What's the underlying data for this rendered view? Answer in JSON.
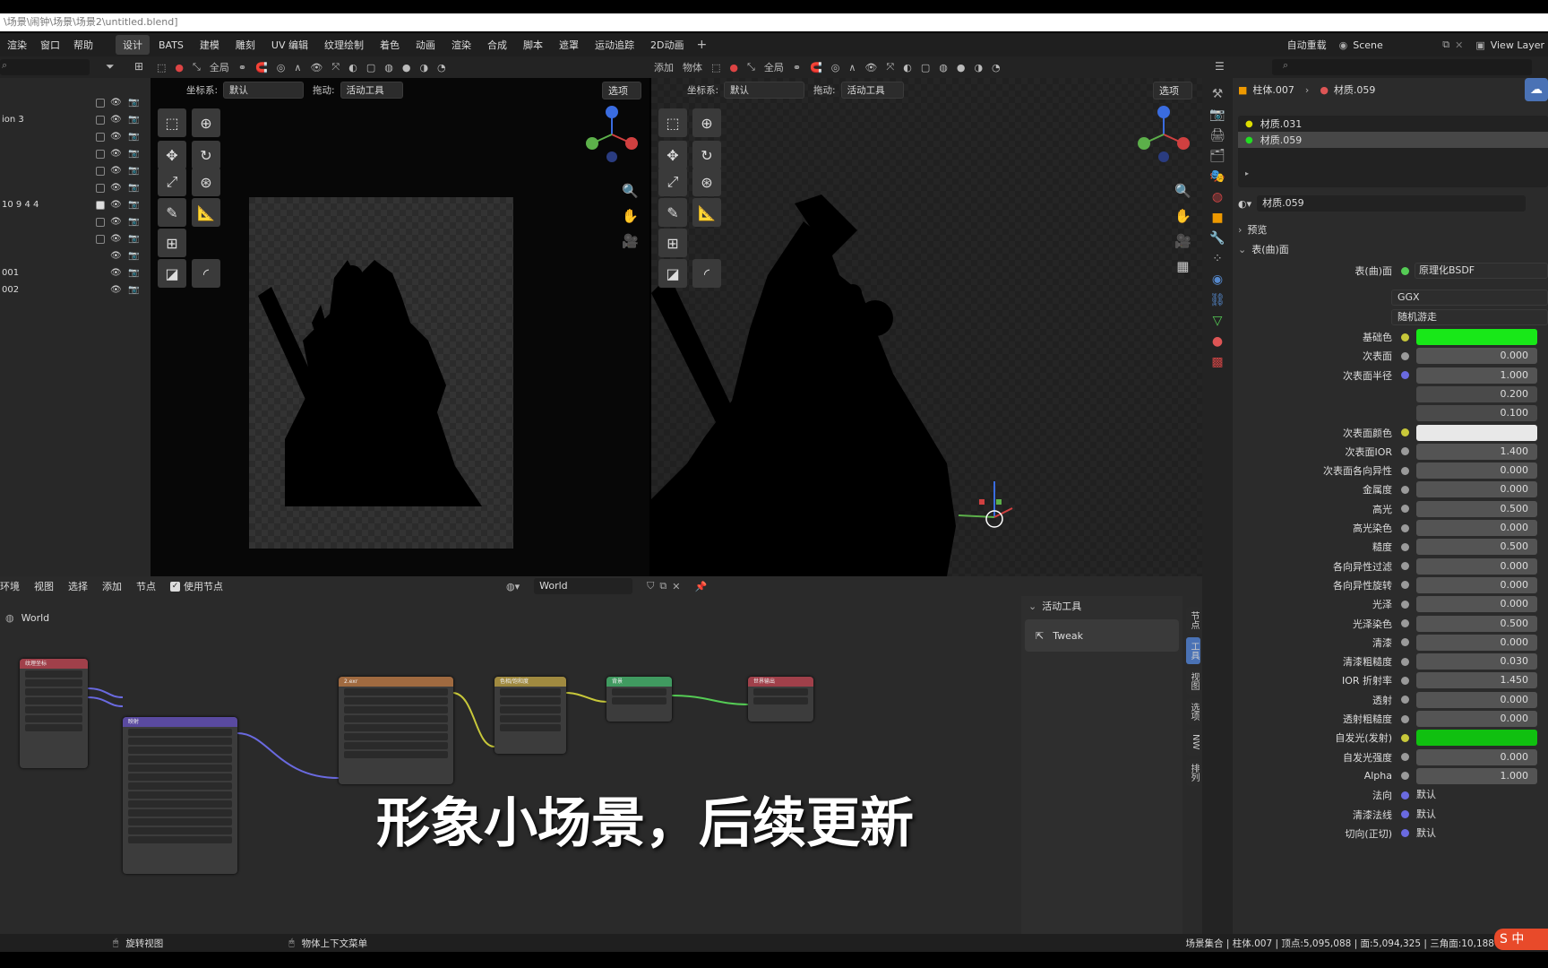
{
  "titlebar": {
    "path": "\\场景\\闹钟\\场景\\场景2\\untitled.blend]"
  },
  "menu": [
    "渲染",
    "窗口",
    "帮助"
  ],
  "workspaces": [
    "设计",
    "BATS",
    "建模",
    "雕刻",
    "UV 编辑",
    "纹理绘制",
    "着色",
    "动画",
    "渲染",
    "合成",
    "脚本",
    "遮罩",
    "运动追踪",
    "2D动画"
  ],
  "active_workspace": "设计",
  "auto_keying": "自动重载",
  "scene": "Scene",
  "view_layer": "View Layer",
  "viewport_left": {
    "coord_label": "坐标系:",
    "coord_value": "默认",
    "drag_label": "拖动:",
    "drag_value": "活动工具",
    "options": "选项",
    "global": "全局"
  },
  "viewport_right": {
    "coord_label": "坐标系:",
    "coord_value": "默认",
    "drag_label": "拖动:",
    "drag_value": "活动工具",
    "options": "选项",
    "global": "全局",
    "add": "添加",
    "object": "物体"
  },
  "outliner": {
    "rows": [
      {
        "label": ""
      },
      {
        "label": "ion 3"
      },
      {
        "label": ""
      },
      {
        "label": ""
      },
      {
        "label": ""
      },
      {
        "label": ""
      },
      {
        "label": "10 9 4 4"
      },
      {
        "label": ""
      },
      {
        "label": ""
      },
      {
        "label": ""
      },
      {
        "label": "001"
      },
      {
        "label": "002"
      }
    ]
  },
  "node_editor": {
    "menu": [
      "环境",
      "视图",
      "选择",
      "添加",
      "节点"
    ],
    "use_nodes": "使用节点",
    "world_name": "World",
    "breadcrumb": "World",
    "sidebar_panel": "活动工具",
    "tool_name": "Tweak",
    "side_tabs": [
      "节点",
      "工具",
      "视图",
      "选项",
      "NW",
      "排列"
    ]
  },
  "overlay_caption": "形象小场景，后续更新",
  "properties": {
    "breadcrumb_object": "柱体.007",
    "breadcrumb_material": "材质.059",
    "slots": [
      "材质.031",
      "材质.059"
    ],
    "material_name": "材质.059",
    "preview_label": "预览",
    "surface_label": "表(曲)面",
    "surface_type_label": "表(曲)面",
    "surface_type": "原理化BSDF",
    "distribution": "GGX",
    "subsurface_method": "随机游走",
    "fields": [
      {
        "label": "基础色",
        "value": "",
        "color": "#18e818",
        "dot": "#c8c83a"
      },
      {
        "label": "次表面",
        "value": "0.000"
      },
      {
        "label": "次表面半径",
        "value": "1.000",
        "dot": "#6a6ae0"
      },
      {
        "label": "",
        "value": "0.200"
      },
      {
        "label": "",
        "value": "0.100"
      },
      {
        "label": "次表面颜色",
        "value": "",
        "color": "#e8e8e8",
        "dot": "#c8c83a"
      },
      {
        "label": "次表面IOR",
        "value": "1.400"
      },
      {
        "label": "次表面各向异性",
        "value": "0.000"
      },
      {
        "label": "金属度",
        "value": "0.000"
      },
      {
        "label": "高光",
        "value": "0.500"
      },
      {
        "label": "高光染色",
        "value": "0.000"
      },
      {
        "label": "糙度",
        "value": "0.500"
      },
      {
        "label": "各向异性过滤",
        "value": "0.000"
      },
      {
        "label": "各向异性旋转",
        "value": "0.000"
      },
      {
        "label": "光泽",
        "value": "0.000"
      },
      {
        "label": "光泽染色",
        "value": "0.500"
      },
      {
        "label": "清漆",
        "value": "0.000"
      },
      {
        "label": "清漆粗糙度",
        "value": "0.030"
      },
      {
        "label": "IOR 折射率",
        "value": "1.450"
      },
      {
        "label": "透射",
        "value": "0.000"
      },
      {
        "label": "透射粗糙度",
        "value": "0.000"
      },
      {
        "label": "自发光(发射)",
        "value": "",
        "color": "#10c010",
        "dot": "#c8c83a"
      },
      {
        "label": "自发光强度",
        "value": "0.000"
      },
      {
        "label": "Alpha",
        "value": "1.000"
      },
      {
        "label": "法向",
        "value": "默认",
        "dot": "#6a6ae0",
        "left": true
      },
      {
        "label": "清漆法线",
        "value": "默认",
        "dot": "#6a6ae0",
        "left": true
      },
      {
        "label": "切向(正切)",
        "value": "默认",
        "dot": "#6a6ae0",
        "left": true
      }
    ]
  },
  "status": {
    "left_hint": "旋转视图",
    "mid_hint": "物体上下文菜单",
    "stats": "场景集合 | 柱体.007 | 顶点:5,095,088 | 面:5,094,325 | 三角面:10,188"
  },
  "colors": {
    "accent": "#4a72b5",
    "panel": "#303030",
    "header": "#232323"
  }
}
